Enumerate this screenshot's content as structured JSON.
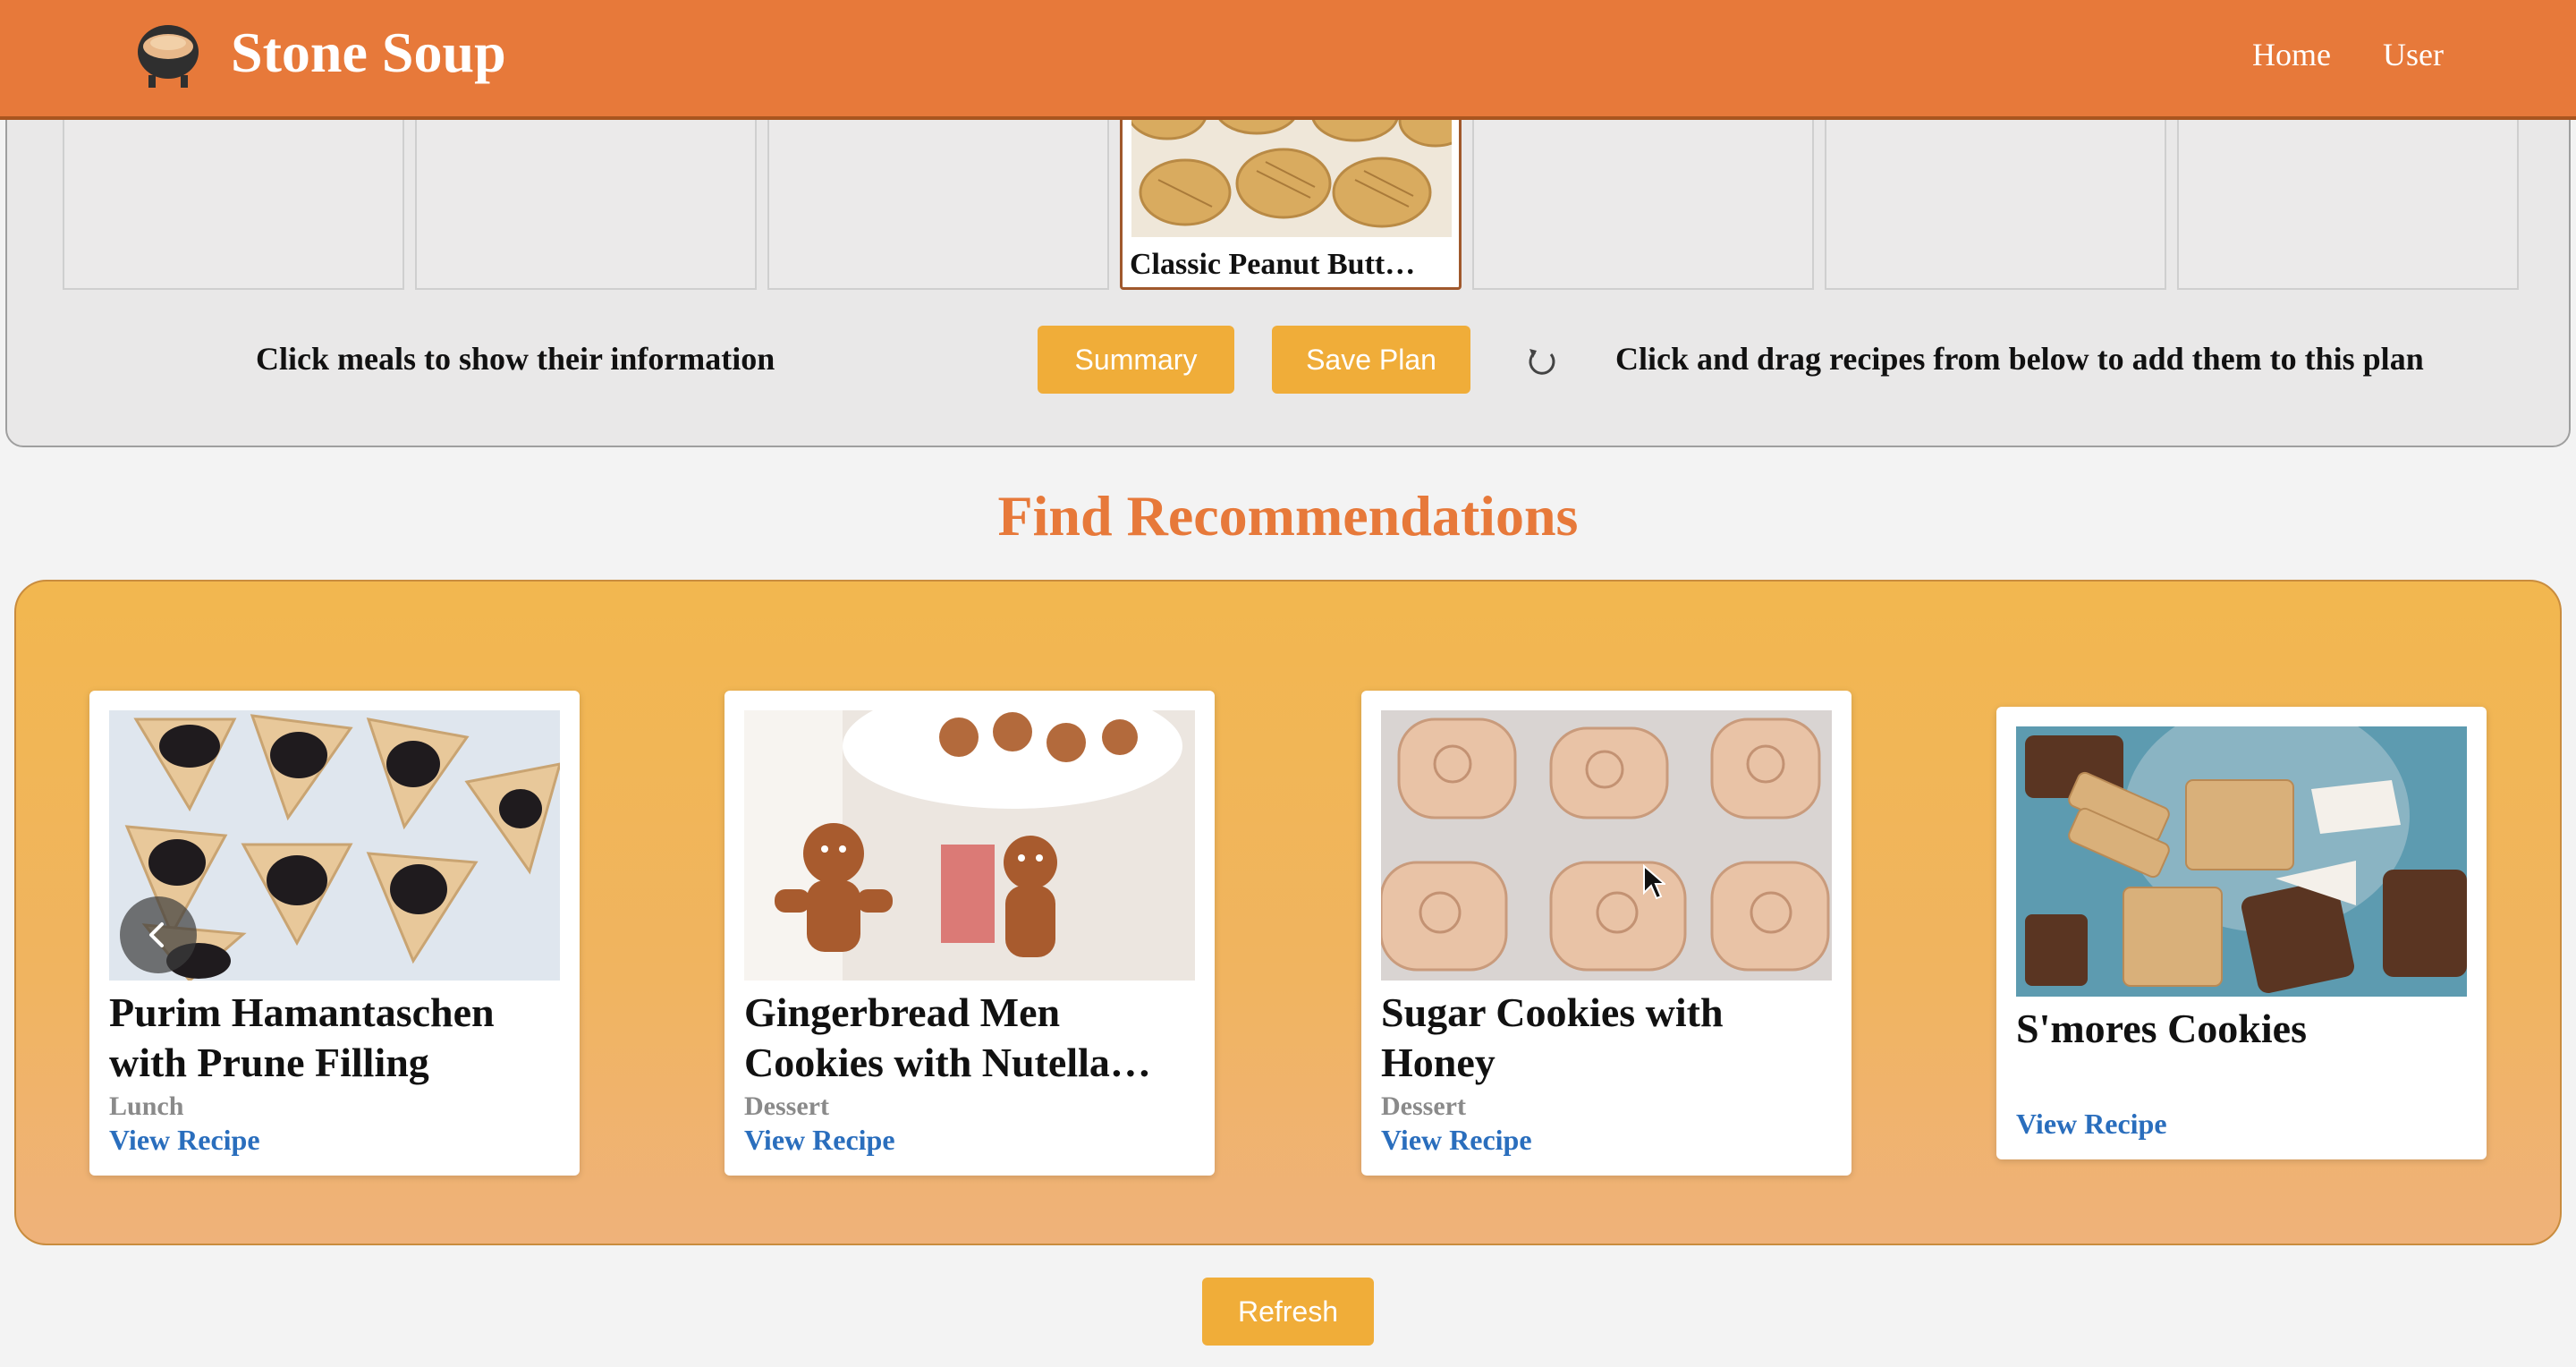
{
  "header": {
    "brand": "Stone Soup",
    "logo_icon": "soup-pot-icon",
    "nav": [
      "Home",
      "User"
    ],
    "color": "#e7793a"
  },
  "planner": {
    "slots": [
      "",
      "",
      "",
      "Classic Peanut Butt…",
      "",
      "",
      ""
    ],
    "left_hint": "Click meals to show their information",
    "summary_label": "Summary",
    "save_label": "Save Plan",
    "right_hint": "Click and drag recipes from below to add them to this plan"
  },
  "recommendations": {
    "title": "Find Recommendations",
    "cards": [
      {
        "title": "Purim Hamantaschen with Prune Filling",
        "category": "Lunch",
        "link": "View Recipe"
      },
      {
        "title": "Gingerbread Men Cookies with Nutella…",
        "category": "Dessert",
        "link": "View Recipe"
      },
      {
        "title": "Sugar Cookies with Honey",
        "category": "Dessert",
        "link": "View Recipe"
      },
      {
        "title": "S'mores Cookies",
        "category": "",
        "link": "View Recipe"
      }
    ],
    "refresh_label": "Refresh",
    "button_color": "#f0ad39",
    "link_color": "#2a6ebd"
  }
}
